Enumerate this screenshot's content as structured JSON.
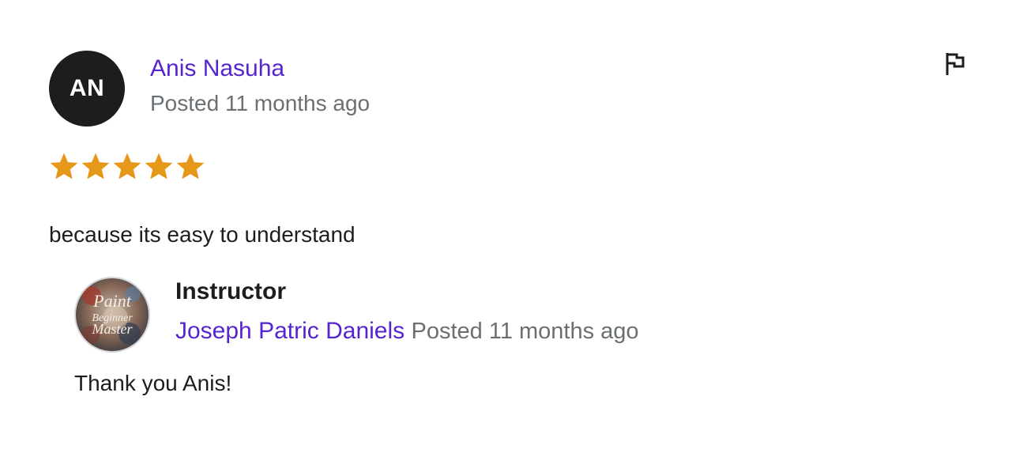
{
  "review": {
    "avatar_initials": "AN",
    "reviewer_name": "Anis Nasuha",
    "posted": "Posted 11 months ago",
    "rating": 5,
    "rating_max": 5,
    "star_color": "#e59819",
    "comment": "because its easy to understand",
    "report_icon": "flag-icon"
  },
  "response": {
    "avatar_text_lines": [
      "Paint",
      "Beginner",
      "Master"
    ],
    "role": "Instructor",
    "instructor_name": "Joseph Patric Daniels",
    "posted": "Posted 11 months ago",
    "text": "Thank you Anis!"
  },
  "colors": {
    "link": "#5624d0",
    "muted": "#6a6f73",
    "text": "#1c1d1f"
  }
}
